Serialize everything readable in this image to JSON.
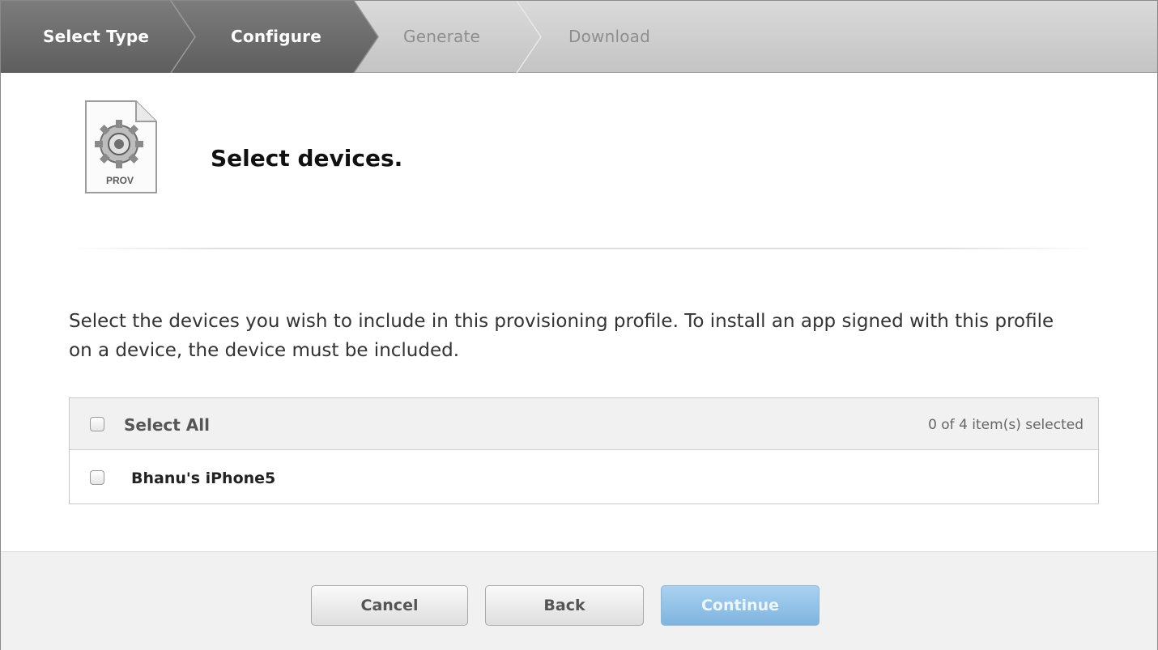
{
  "steps": [
    {
      "label": "Select Type",
      "state": "done"
    },
    {
      "label": "Configure",
      "state": "current"
    },
    {
      "label": "Generate",
      "state": "upcoming"
    },
    {
      "label": "Download",
      "state": "upcoming"
    }
  ],
  "header": {
    "icon_label": "PROV",
    "title": "Select devices."
  },
  "description": "Select the devices you wish to include in this provisioning profile. To install an app signed with this profile on a device, the device must be included.",
  "device_table": {
    "select_all_label": "Select All",
    "selected_count": "0 of 4 item(s) selected",
    "devices": [
      {
        "name": "Bhanu's iPhone5",
        "checked": false
      }
    ]
  },
  "footer": {
    "cancel_label": "Cancel",
    "back_label": "Back",
    "continue_label": "Continue"
  },
  "colors": {
    "step_active": "#6d6d6d",
    "step_inactive": "#cfcfcf",
    "continue_button": "#92c2e6"
  }
}
